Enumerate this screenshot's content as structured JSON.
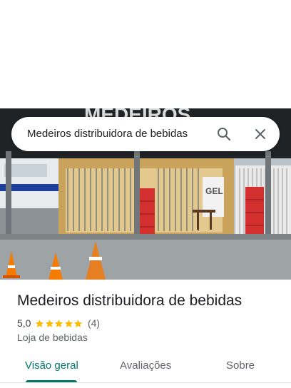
{
  "search": {
    "query": "Medeiros distribuidora de bebidas"
  },
  "place": {
    "name": "Medeiros distribuidora de bebidas",
    "rating": "5,0",
    "stars": 5,
    "reviews": "(4)",
    "category": "Loja de bebidas"
  },
  "photo": {
    "sign_text": "MEDEIROS",
    "inner_sign": "GEL"
  },
  "tabs": [
    {
      "label": "Visão geral",
      "active": true
    },
    {
      "label": "Avaliações",
      "active": false
    },
    {
      "label": "Sobre",
      "active": false
    }
  ],
  "colors": {
    "accent": "#00796b",
    "star": "#fbbc04",
    "text": "#202124",
    "secondary": "#5f6368"
  },
  "icons": [
    "search-icon",
    "close-icon",
    "star-icon"
  ]
}
